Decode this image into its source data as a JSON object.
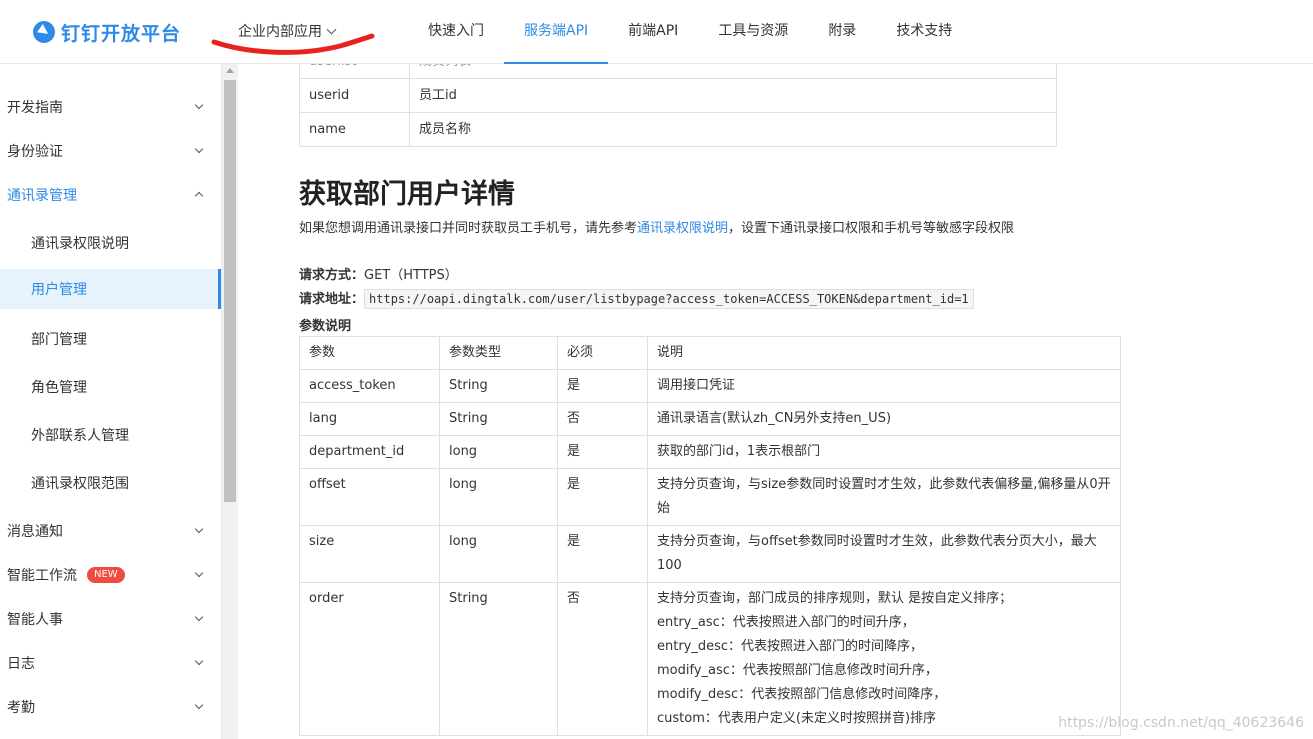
{
  "header": {
    "logo_text": "钉钉开放平台",
    "app_switch": "企业内部应用",
    "nav": [
      "快速入门",
      "服务端API",
      "前端API",
      "工具与资源",
      "附录",
      "技术支持"
    ],
    "active_nav": "服务端API"
  },
  "sidebar": {
    "items": [
      {
        "label": "开发指南",
        "level": 1,
        "state": "collapsed"
      },
      {
        "label": "身份验证",
        "level": 1,
        "state": "collapsed"
      },
      {
        "label": "通讯录管理",
        "level": 1,
        "state": "expanded"
      },
      {
        "label": "通讯录权限说明",
        "level": 2
      },
      {
        "label": "用户管理",
        "level": 2,
        "selected": true
      },
      {
        "label": "部门管理",
        "level": 2
      },
      {
        "label": "角色管理",
        "level": 2
      },
      {
        "label": "外部联系人管理",
        "level": 2
      },
      {
        "label": "通讯录权限范围",
        "level": 2
      },
      {
        "label": "消息通知",
        "level": 1,
        "state": "collapsed"
      },
      {
        "label": "智能工作流",
        "level": 1,
        "state": "collapsed",
        "badge": "NEW"
      },
      {
        "label": "智能人事",
        "level": 1,
        "state": "collapsed"
      },
      {
        "label": "日志",
        "level": 1,
        "state": "collapsed"
      },
      {
        "label": "考勤",
        "level": 1,
        "state": "collapsed"
      }
    ]
  },
  "content": {
    "top_table": [
      [
        "userid",
        "员工id"
      ],
      [
        "name",
        "成员名称"
      ]
    ],
    "title": "获取部门用户详情",
    "intro_before": "如果您想调用通讯录接口并同时获取员工手机号，请先参考",
    "intro_link": "通讯录权限说明",
    "intro_after": "，设置下通讯录接口权限和手机号等敏感字段权限",
    "method_label": "请求方式：",
    "method_value": "GET（HTTPS）",
    "url_label": "请求地址：",
    "url_value": "https://oapi.dingtalk.com/user/listbypage?access_token=ACCESS_TOKEN&department_id=1",
    "params_label": "参数说明",
    "params_header": [
      "参数",
      "参数类型",
      "必须",
      "说明"
    ],
    "params_rows": [
      [
        "access_token",
        "String",
        "是",
        "调用接口凭证"
      ],
      [
        "lang",
        "String",
        "否",
        "通讯录语言(默认zh_CN另外支持en_US)"
      ],
      [
        "department_id",
        "long",
        "是",
        "获取的部门id，1表示根部门"
      ],
      [
        "offset",
        "long",
        "是",
        "支持分页查询，与size参数同时设置时才生效，此参数代表偏移量,偏移量从0开始"
      ],
      [
        "size",
        "long",
        "是",
        "支持分页查询，与offset参数同时设置时才生效，此参数代表分页大小，最大100"
      ],
      [
        "order",
        "String",
        "否",
        "支持分页查询，部门成员的排序规则，默认 是按自定义排序；\nentry_asc：代表按照进入部门的时间升序，\nentry_desc：代表按照进入部门的时间降序，\nmodify_asc：代表按照部门信息修改时间升序，\nmodify_desc：代表按照部门信息修改时间降序，\ncustom：代表用户定义(未定义时按照拼音)排序"
      ]
    ]
  },
  "watermark": "https://blog.csdn.net/qq_40623646",
  "colors": {
    "accent": "#2e8ae6",
    "badge": "#f04b43",
    "annotation": "#e8231f"
  }
}
